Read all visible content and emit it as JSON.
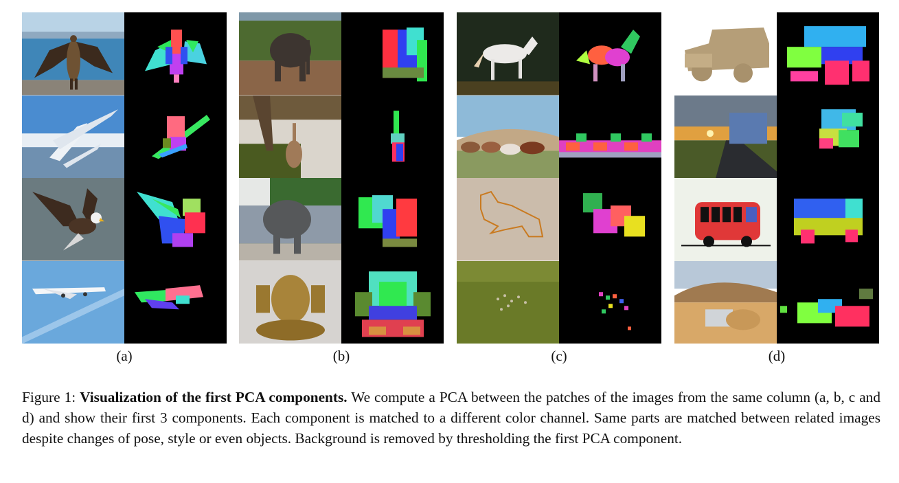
{
  "figure": {
    "panels": [
      {
        "label": "(a)",
        "rows": [
          {
            "image": "juvenile eagle with spread wings standing on a shore",
            "pca": "eagle-pca-map"
          },
          {
            "image": "airplane banking over mountains",
            "pca": "airplane-pca-map"
          },
          {
            "image": "bald eagle swooping with talons forward",
            "pca": "eagle-pca-map"
          },
          {
            "image": "airliner in a blue sky",
            "pca": "airplane-pca-map"
          }
        ]
      },
      {
        "label": "(b)",
        "rows": [
          {
            "image": "elephant standing on dirt ground",
            "pca": "elephant-pca-map"
          },
          {
            "image": "elephant reaching up into a tree",
            "pca": "elephant-pca-map"
          },
          {
            "image": "elephant in a zoo enclosure",
            "pca": "elephant-pca-map"
          },
          {
            "image": "brass Ganesha statue",
            "pca": "statue-pca-map"
          }
        ]
      },
      {
        "label": "(c)",
        "rows": [
          {
            "image": "white horse galloping",
            "pca": "horse-pca-map"
          },
          {
            "image": "herd of horses running",
            "pca": "herd-pca-map"
          },
          {
            "image": "orange line drawing of a horse",
            "pca": "drawing-pca-map"
          },
          {
            "image": "aerial view of a herd on a green field",
            "pca": "aerial-herd-pca-map"
          }
        ]
      },
      {
        "label": "(d)",
        "rows": [
          {
            "image": "cardboard jeep model",
            "pca": "jeep-pca-map"
          },
          {
            "image": "blue coach bus on a road at sunset",
            "pca": "bus-pca-map"
          },
          {
            "image": "red cartoon bus illustration",
            "pca": "cartoon-bus-pca-map"
          },
          {
            "image": "SUV driving on desert dunes",
            "pca": "suv-pca-map"
          }
        ]
      }
    ],
    "caption": {
      "prefix": "Figure 1: ",
      "bold": "Visualization of the first PCA components.",
      "body": " We compute a PCA between the patches of the images from the same column (a, b, c and d) and show their first 3 components. Each component is matched to a different color channel. Same parts are matched between related images despite changes of pose, style or even objects. Background is removed by thresholding the first PCA component."
    }
  }
}
